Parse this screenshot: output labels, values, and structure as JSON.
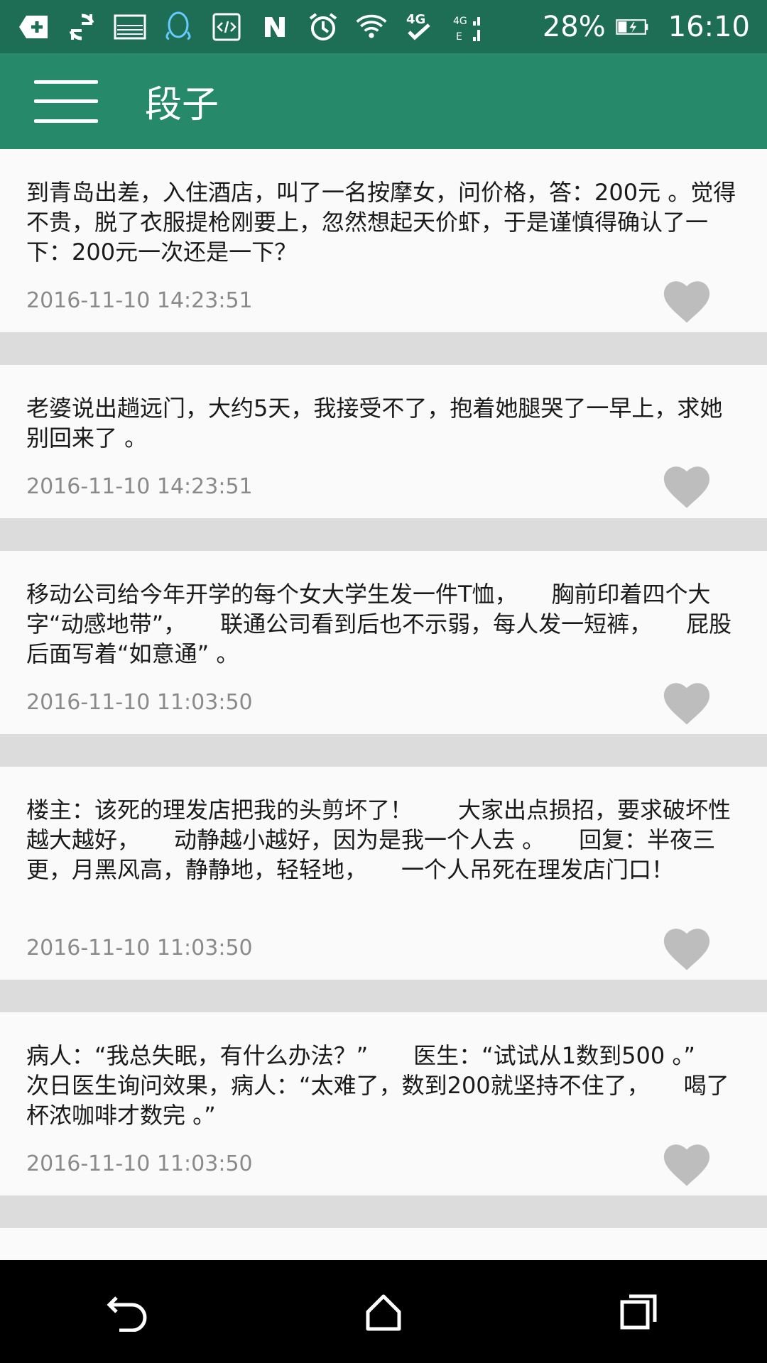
{
  "status_bar": {
    "icons": [
      "add-box-icon",
      "sync-icon",
      "image-icon",
      "qq-icon",
      "code-icon",
      "nfc-icon",
      "alarm-icon",
      "wifi-icon",
      "4g-check-icon",
      "signal-icon",
      "battery-icon"
    ],
    "battery": "28%",
    "time": "16:10"
  },
  "app_bar": {
    "title": "段子"
  },
  "posts": [
    {
      "text": "到青岛出差，入住酒店，叫了一名按摩女，问价格，答：200元 。觉得不贵，脱了衣服提枪刚要上，忽然想起天价虾，于是谨慎得确认了一下：200元一次还是一下？",
      "time": "2016-11-10 14:23:51"
    },
    {
      "text": "老婆说出趟远门，大约5天，我接受不了，抱着她腿哭了一早上，求她别回来了 。",
      "time": "2016-11-10 14:23:51"
    },
    {
      "text": "移动公司给今年开学的每个女大学生发一件T恤，　　胸前印着四个大字“动感地带”，　　联通公司看到后也不示弱，每人发一短裤，　　屁股后面写着“如意通” 。",
      "time": "2016-11-10 11:03:50"
    },
    {
      "text": "楼主：该死的理发店把我的头剪坏了！　　大家出点损招，要求破坏性越大越好，　　动静越小越好，因为是我一个人去 。　　回复：半夜三更，月黑风高，静静地，轻轻地，　　一个人吊死在理发店门口！",
      "time": "2016-11-10 11:03:50"
    },
    {
      "text": "病人：“我总失眠，有什么办法？”　　医生：“试试从1数到500 。”　　次日医生询问效果，病人：“太难了，数到200就坚持不住了，　　喝了杯浓咖啡才数完 。”",
      "time": "2016-11-10 11:03:50"
    }
  ],
  "nav_bar": {
    "icons": [
      "back-icon",
      "home-icon",
      "recents-icon"
    ]
  },
  "colors": {
    "status_bar": "#1e6e56",
    "app_bar": "#268a6a",
    "card": "#fafafa",
    "divider": "#dcdcdc",
    "like": "#bdbdbd"
  }
}
